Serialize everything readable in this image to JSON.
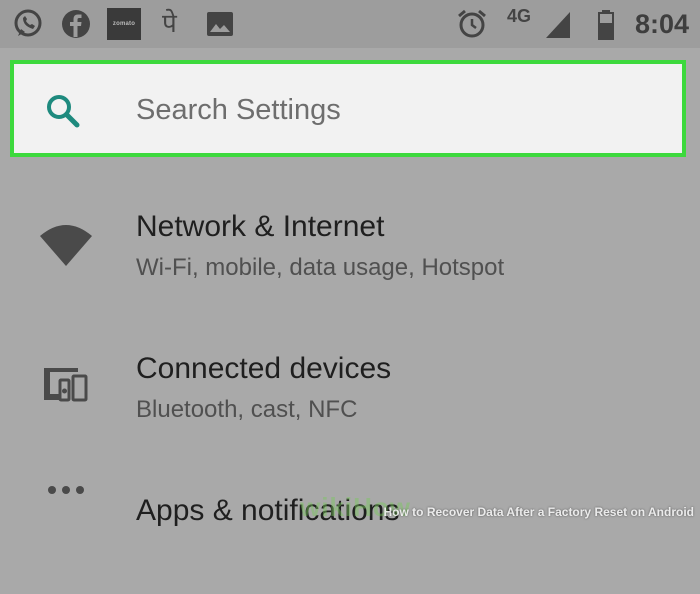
{
  "status_bar": {
    "icons": [
      "whatsapp-icon",
      "facebook-icon",
      "zomato-logo",
      "phonepe-icon",
      "image-icon",
      "alarm-icon",
      "signal-icon",
      "battery-icon"
    ],
    "zomato_text": "zomato",
    "phonepe_text": "पे",
    "network": "4G",
    "time": "8:04"
  },
  "search": {
    "placeholder": "Search Settings",
    "border_color": "#3dd93d",
    "icon_color": "#1e8a7e"
  },
  "settings": {
    "items": [
      {
        "title": "Network & Internet",
        "subtitle": "Wi-Fi, mobile, data usage, Hotspot",
        "icon": "wifi-icon"
      },
      {
        "title": "Connected devices",
        "subtitle": "Bluetooth, cast, NFC",
        "icon": "devices-icon"
      },
      {
        "title": "Apps & notifications",
        "subtitle": "",
        "icon": "apps-icon"
      }
    ]
  },
  "watermark": {
    "text": "How to Recover Data After a Factory Reset on Android",
    "brand": "wikiHow"
  }
}
